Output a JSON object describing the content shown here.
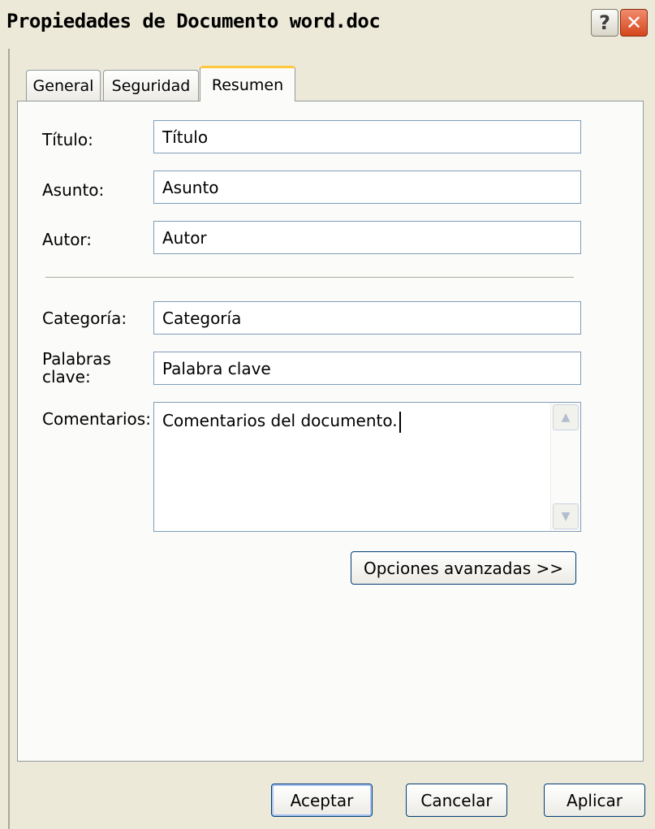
{
  "window": {
    "title": "Propiedades de Documento word.doc",
    "help_label": "?",
    "close_label": "✕"
  },
  "tabs": [
    {
      "label": "General"
    },
    {
      "label": "Seguridad"
    },
    {
      "label": "Resumen",
      "active": true
    }
  ],
  "fields": {
    "titulo": {
      "label": "Título:",
      "value": "Título"
    },
    "asunto": {
      "label": "Asunto:",
      "value": "Asunto"
    },
    "autor": {
      "label": "Autor:",
      "value": "Autor"
    },
    "categoria": {
      "label": "Categoría:",
      "value": "Categoría"
    },
    "palabras_clave": {
      "label_line1": "Palabras",
      "label_line2": "clave:",
      "value": "Palabra clave"
    },
    "comentarios": {
      "label": "Comentarios:",
      "value": "Comentarios del documento."
    }
  },
  "scroll": {
    "up_icon": "▲",
    "down_icon": "▼"
  },
  "buttons": {
    "advanced": "Opciones avanzadas >>",
    "ok": "Aceptar",
    "cancel": "Cancelar",
    "apply": "Aplicar"
  },
  "colors": {
    "dialog_bg": "#ece9d8",
    "panel_bg": "#fbfbf9",
    "field_border": "#7f9db9",
    "tab_highlight": "#ffc83c",
    "close_button": "#d5471c"
  }
}
